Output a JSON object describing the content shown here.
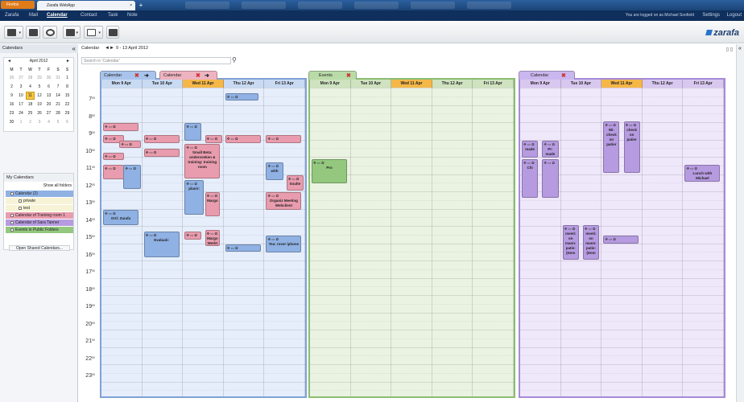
{
  "browser": {
    "menu": "Firefox",
    "tab_title": "Zarafa WebApp",
    "close": "×",
    "new_tab": "+"
  },
  "appnav": {
    "items": [
      "Zarafa",
      "Mail",
      "Calendar",
      "Contact",
      "Task",
      "Note"
    ],
    "logged_in": "You are logged on as Michael Soofield",
    "settings": "Settings",
    "logout": "Logout"
  },
  "logo": "zarafa",
  "sidebar": {
    "title": "Calendars",
    "collapse": "«",
    "minical": {
      "month": "April 2012",
      "prev": "◄",
      "next": "►",
      "weekdays": [
        "M",
        "T",
        "W",
        "T",
        "F",
        "S",
        "S"
      ],
      "weeks": [
        [
          "26",
          "27",
          "28",
          "29",
          "30",
          "31",
          "1"
        ],
        [
          "2",
          "3",
          "4",
          "5",
          "6",
          "7",
          "8"
        ],
        [
          "9",
          "10",
          "11",
          "12",
          "13",
          "14",
          "15"
        ],
        [
          "16",
          "17",
          "18",
          "19",
          "20",
          "21",
          "22"
        ],
        [
          "23",
          "24",
          "25",
          "26",
          "27",
          "28",
          "29"
        ],
        [
          "30",
          "1",
          "2",
          "3",
          "4",
          "5",
          "6"
        ]
      ]
    },
    "my_calendars": {
      "title": "My Calendars",
      "show_all": "Show all folders",
      "items": [
        {
          "label": "Calendar (2)",
          "color": "#8fb1e3"
        },
        {
          "label": "private",
          "color": "#f7f3d6"
        },
        {
          "label": "test",
          "color": "#f7f3d6"
        },
        {
          "label": "Calendar of Training room 1",
          "color": "#e99cae"
        },
        {
          "label": "Calendar of Sara Tanner",
          "color": "#b69be0"
        },
        {
          "label": "Events in Public Folders",
          "color": "#93c87e"
        }
      ],
      "open_shared": "Open Shared Calendars..."
    }
  },
  "main": {
    "title": "Calendar",
    "prev": "◄",
    "next": "►",
    "date_range": "9 - 13 April 2012",
    "search_placeholder": "Search in 'Calendar'",
    "search_icon": "⚲"
  },
  "hours": [
    "7",
    "8",
    "9",
    "10",
    "11",
    "12",
    "13",
    "14",
    "15",
    "16",
    "17",
    "18",
    "19",
    "20",
    "21",
    "22",
    "23"
  ],
  "minutes": "00",
  "days": [
    "Mon 9 Apr",
    "Tue 10 Apr",
    "Wed 11 Apr",
    "Thu 12 Apr",
    "Fri 13 Apr"
  ],
  "panels": [
    {
      "tab": "Calendar",
      "color": "#e6eefb",
      "header": "#c9daf3",
      "border": "#7fa2d6",
      "tabcolor": "#a9c4ec"
    },
    {
      "tab": "Calendar",
      "color": "#e6eefb",
      "header": "#c9daf3",
      "border": "#7fa2d6",
      "tabcolor": "#eeb3c0"
    },
    {
      "tab": "Events",
      "color": "#eaf2e2",
      "header": "#cfe3c0",
      "border": "#8bbd72",
      "tabcolor": "#b9dba8"
    },
    {
      "tab": "Calendar",
      "color": "#efe7fa",
      "header": "#d8c8f0",
      "border": "#a58bd8",
      "tabcolor": "#cbb7ef"
    }
  ],
  "event_icons": "✥▭✿",
  "events": {
    "p1": [
      "",
      "Orti: Zarafa",
      "",
      "Evaluati:",
      "",
      "planir:",
      "Margo",
      "",
      "Margo Werkt Oranje",
      "",
      "with",
      "Soulte",
      "Organiz Meeting Webclient",
      "Tea: rover iphone"
    ],
    "p2": [
      "Pro"
    ],
    "p3": [
      "Wi- check on patier",
      "check on patier",
      "made",
      "Pr: made",
      "Chi",
      "Lunch with Michael",
      "meeti: on mann: patie: (Dem",
      "meeti: on mann: patie: (Dem"
    ],
    "p1b": [
      "Small Beta: onderzoeken & training: training room"
    ]
  }
}
